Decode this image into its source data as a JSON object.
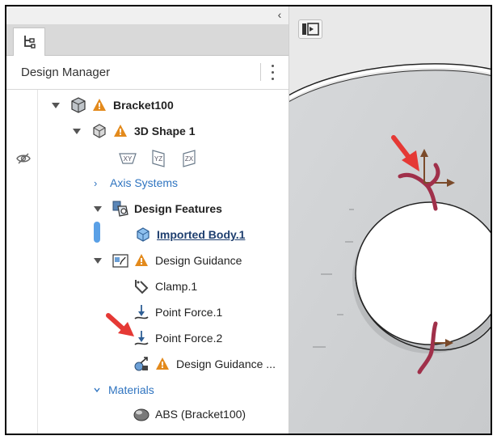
{
  "panel": {
    "collapse_glyph": "‹",
    "tab_icon": "tree-structure-icon",
    "title": "Design Manager",
    "menu_icon": "kebab-menu-icon"
  },
  "tree": {
    "root": {
      "label": "Bracket100",
      "icon": "part-icon",
      "warning": true
    },
    "shape": {
      "label": "3D Shape 1",
      "icon": "shape-icon",
      "warning": true
    },
    "planes": [
      "XY",
      "YZ",
      "ZX"
    ],
    "axis_systems": {
      "label": "Axis Systems"
    },
    "design_features": {
      "label": "Design Features"
    },
    "imported_body": {
      "label": "Imported Body.1"
    },
    "design_guidance": {
      "label": "Design Guidance",
      "warning": true
    },
    "clamp": {
      "label": "Clamp.1"
    },
    "point_force_1": {
      "label": "Point Force.1"
    },
    "point_force_2": {
      "label": "Point Force.2"
    },
    "design_guidance_item": {
      "label": "Design Guidance ...",
      "warning": true
    },
    "materials": {
      "label": "Materials"
    },
    "material_abs": {
      "label": "ABS (Bracket100)"
    }
  },
  "colors": {
    "accent": "#2f74c0",
    "warning": "#e38a1c",
    "annotation_arrow": "#e53935",
    "force_glyph": "#a0304a"
  }
}
